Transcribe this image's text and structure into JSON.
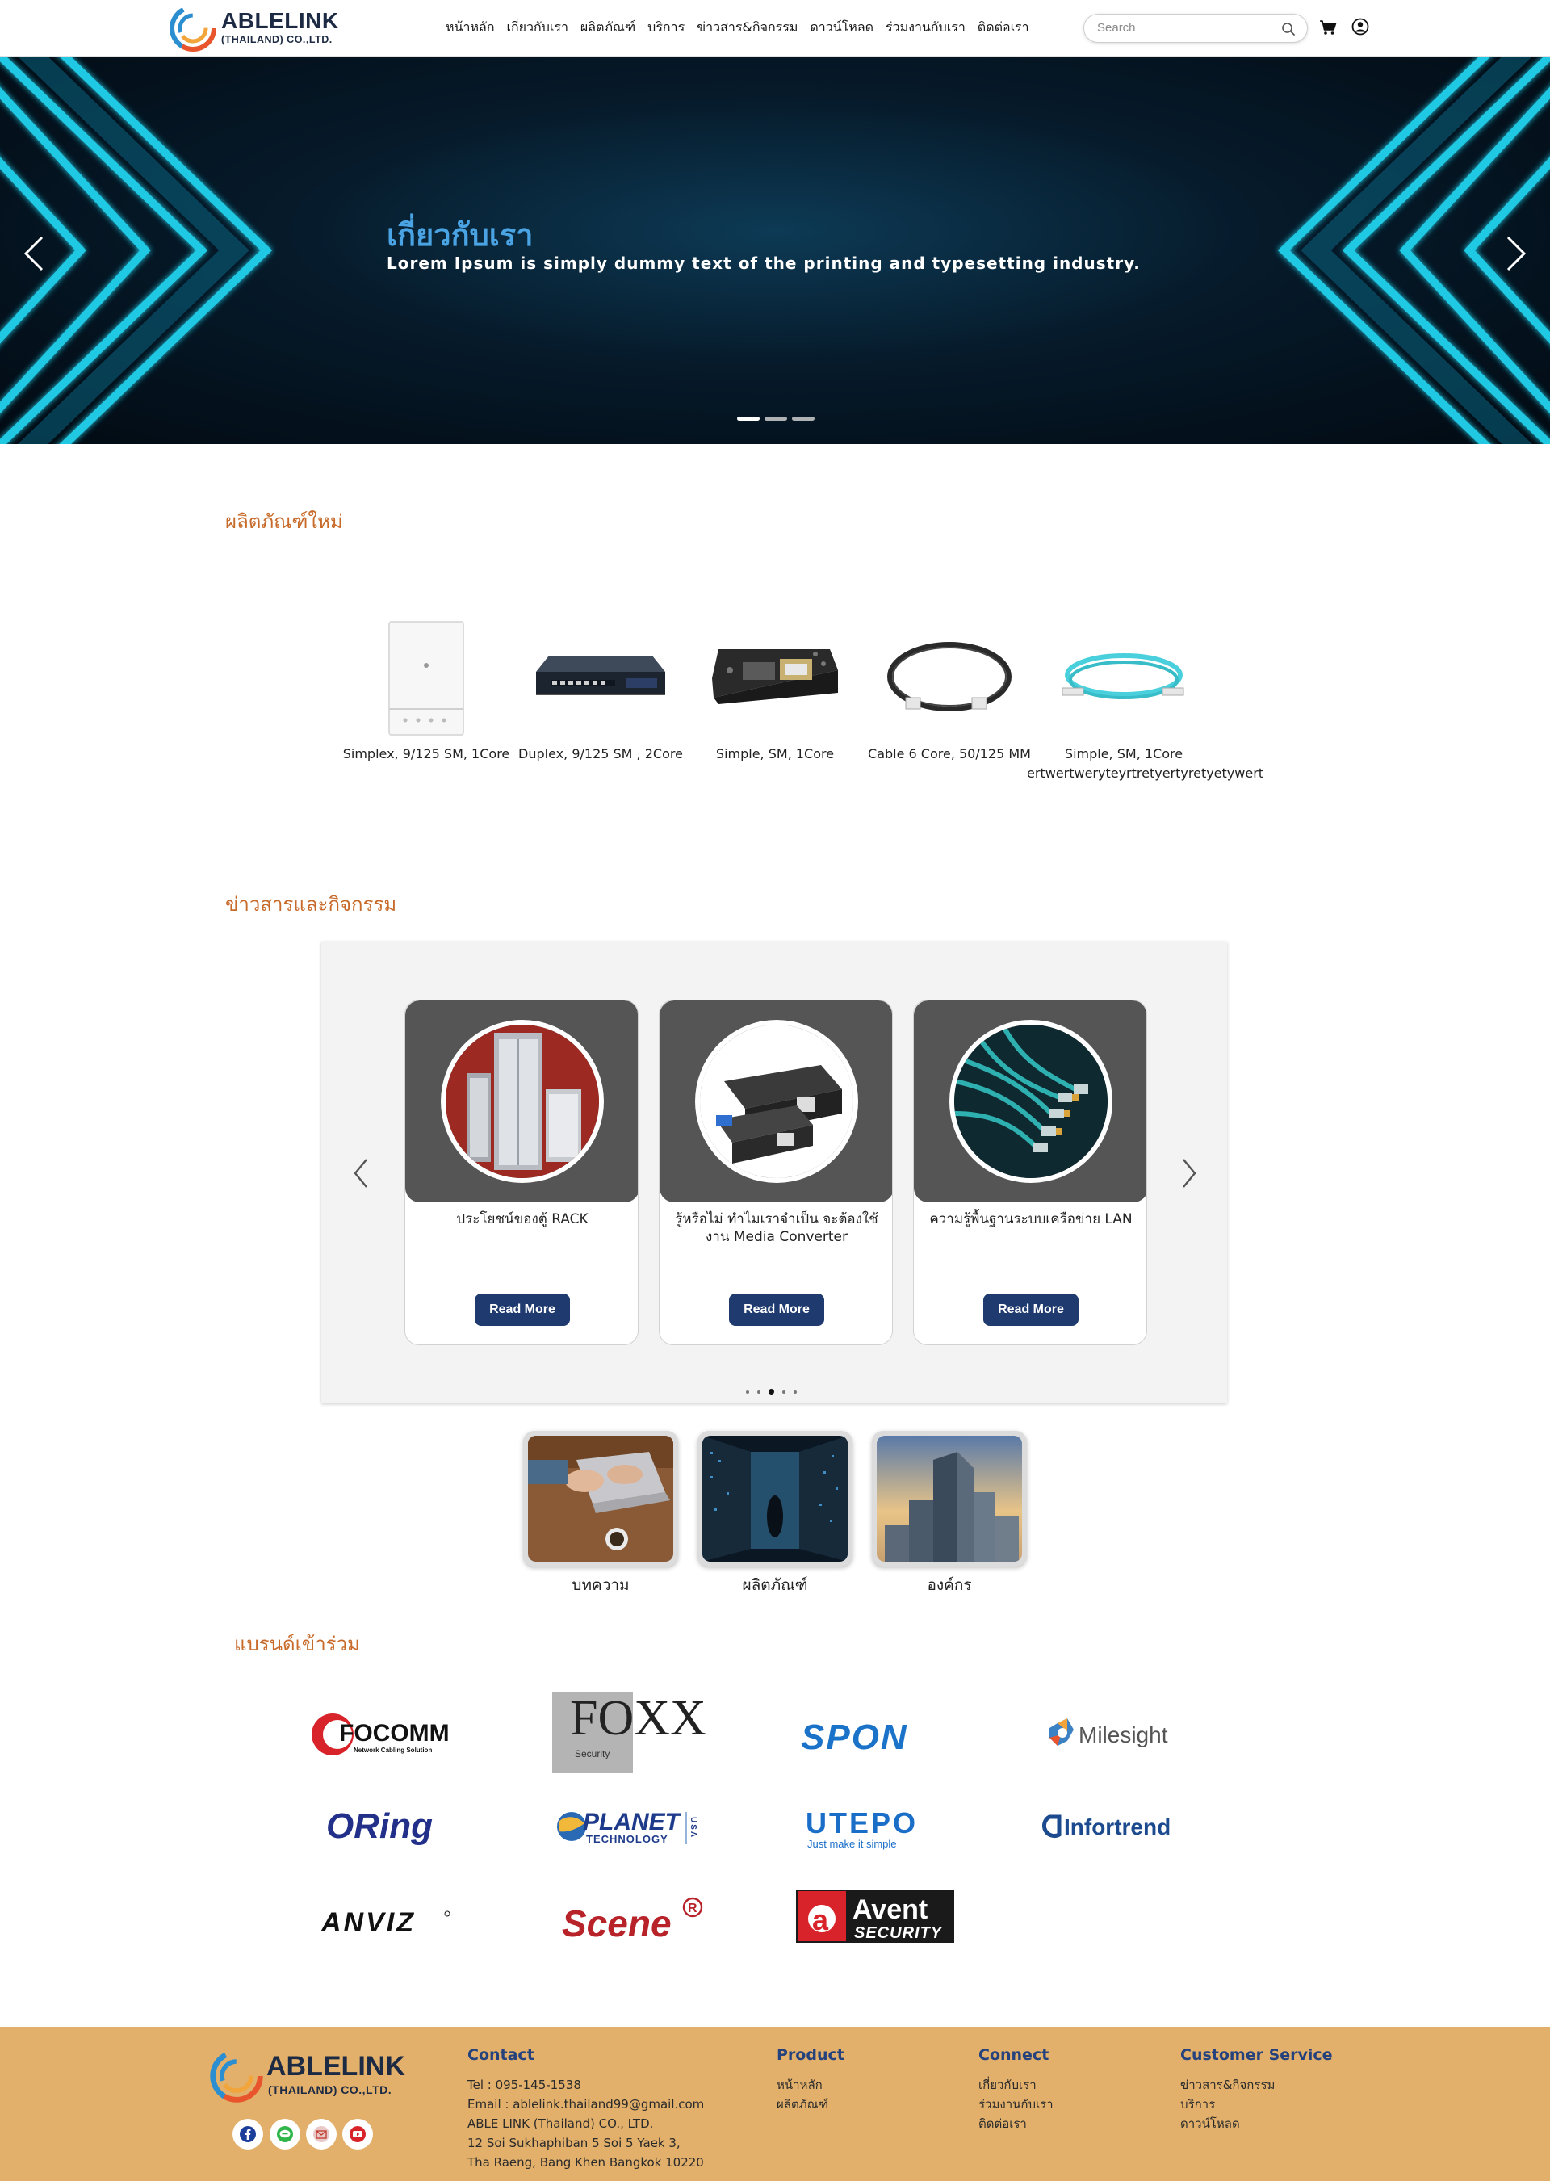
{
  "header": {
    "logo_text": "ABLELINK",
    "logo_sub": "(THAILAND) CO.,LTD.",
    "nav": [
      "หน้าหลัก",
      "เกี่ยวกับเรา",
      "ผลิตภัณฑ์",
      "บริการ",
      "ข่าวสาร&กิจกรรม",
      "ดาวน์โหลด",
      "ร่วมงานกับเรา",
      "ติดต่อเรา"
    ],
    "search_placeholder": "Search"
  },
  "hero": {
    "title": "เกี่ยวกับเรา",
    "subtitle": "Lorem Ipsum is simply dummy text of the printing and typesetting industry.",
    "slide_count": 3,
    "active_slide": 1
  },
  "new_products": {
    "title": "ผลิตภัณฑ์ใหม่",
    "items": [
      {
        "name": "Simplex, 9/125 SM, 1Core",
        "icon": "access-point-icon"
      },
      {
        "name": "Duplex, 9/125 SM , 2Core",
        "icon": "network-switch-icon"
      },
      {
        "name": "Simple, SM, 1Core",
        "icon": "circuit-board-icon"
      },
      {
        "name": "Cable 6 Core, 50/125 MM",
        "icon": "black-cable-icon"
      },
      {
        "name": "Simple, SM, 1Core ertwertweryteyrtretyertyretyetywert",
        "icon": "aqua-fiber-cable-icon"
      }
    ]
  },
  "news": {
    "title": "ข่าวสารและกิจกรรม",
    "read_more": "Read More",
    "cards": [
      {
        "title": "ประโยชน์ของตู้ RACK",
        "icon": "server-rack-image"
      },
      {
        "title": "รู้หรือไม่ ทำไมเราจำเป็น จะต้องใช้งาน Media Converter",
        "icon": "media-converter-image"
      },
      {
        "title": "ความรู้พื้นฐานระบบเครือข่าย LAN",
        "icon": "lan-cable-image"
      }
    ],
    "dot_count": 5,
    "active_dot": 3
  },
  "categories": [
    {
      "label": "บทความ",
      "icon": "laptop-desk-image"
    },
    {
      "label": "ผลิตภัณฑ์",
      "icon": "datacenter-image"
    },
    {
      "label": "องค์กร",
      "icon": "office-building-image"
    }
  ],
  "brands": {
    "title": "แบรนด์เข้าร่วม",
    "items": [
      {
        "name": "FOCOMM",
        "tagline": "Network Cabling Solution"
      },
      {
        "name": "FOXX",
        "tagline": "Security"
      },
      {
        "name": "SPON"
      },
      {
        "name": "Milesight"
      },
      {
        "name": "ORing"
      },
      {
        "name": "PLANET",
        "tagline": "TECHNOLOGY",
        "side": "USA"
      },
      {
        "name": "UTEPO",
        "tagline": "Just make it simple"
      },
      {
        "name": "Infortrend"
      },
      {
        "name": "ANVIZ"
      },
      {
        "name": "Scene"
      },
      {
        "name": "Avent",
        "tagline": "SECURITY"
      }
    ]
  },
  "footer": {
    "logo_text": "ABLELINK",
    "logo_sub": "(THAILAND) CO.,LTD.",
    "contact": {
      "heading": "Contact",
      "lines": [
        "Tel : 095-145-1538",
        "Email : ablelink.thailand99@gmail.com",
        "ABLE LINK (Thailand) CO., LTD.",
        "12 Soi Sukhaphiban 5 Soi 5 Yaek 3,",
        "Tha Raeng, Bang Khen Bangkok 10220"
      ]
    },
    "product": {
      "heading": "Product",
      "links": [
        "หน้าหลัก",
        "ผลิตภัณฑ์"
      ]
    },
    "connect": {
      "heading": "Connect",
      "links": [
        "เกี่ยวกับเรา",
        "ร่วมงานกับเรา",
        "ติดต่อเรา"
      ]
    },
    "customer_service": {
      "heading": "Customer Service",
      "links": [
        "ข่าวสาร&กิจกรรม",
        "บริการ",
        "ดาวน์โหลด"
      ]
    },
    "social": [
      "facebook-icon",
      "line-icon",
      "email-icon",
      "youtube-icon"
    ]
  },
  "colors": {
    "accent_orange": "#c76a2a",
    "button_navy": "#1e3a6e",
    "footer_bg": "#e2b06b",
    "footer_heading": "#25427d",
    "hero_title": "#4aa3e3"
  }
}
